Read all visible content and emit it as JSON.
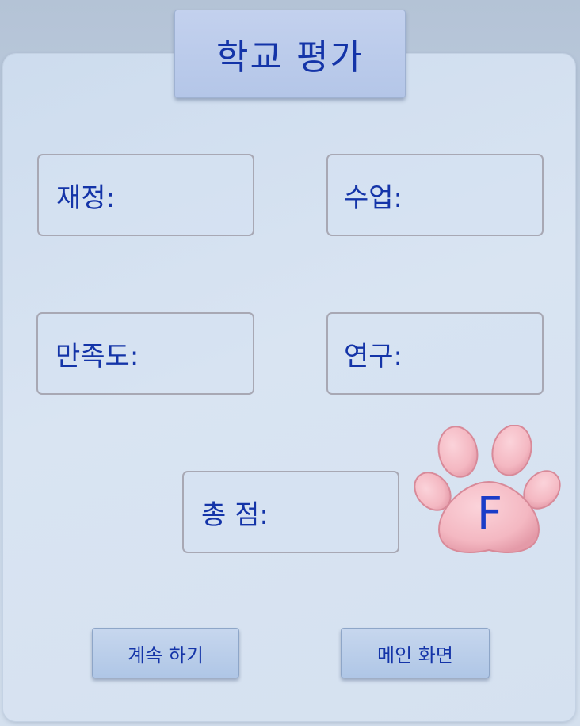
{
  "title": "학교 평가",
  "fields": {
    "finance": "재정:",
    "teaching": "수업:",
    "satisfaction": "만족도:",
    "research": "연구:",
    "total": "총 점:"
  },
  "grade": "F",
  "buttons": {
    "continue": "계속 하기",
    "main_menu": "메인 화면"
  },
  "colors": {
    "text": "#1434a8",
    "paw": "#f4b8c2"
  },
  "icons": {
    "grade_badge": "paw-print-icon"
  }
}
